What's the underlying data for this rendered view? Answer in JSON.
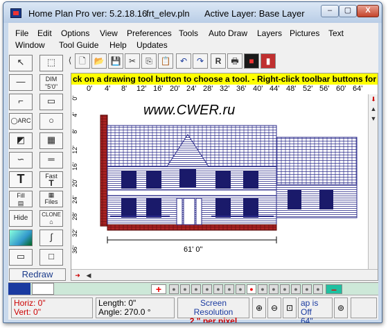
{
  "window": {
    "app_name": "Home Plan Pro ver: 5.2.18.16",
    "file_name": "frt_elev.pln",
    "active_layer": "Active Layer: Base Layer",
    "controls": [
      "–",
      "▢",
      "X"
    ]
  },
  "menu": {
    "row1": [
      "File",
      "Edit",
      "Options",
      "View",
      "Preferences",
      "Tools",
      "Auto Draw",
      "Layers",
      "Pictures",
      "Text"
    ],
    "row2": [
      "Window",
      "Tool Guide",
      "Help",
      "Updates"
    ]
  },
  "toolbar": {
    "icons": [
      "frame-icon",
      "new-file-icon",
      "open-folder-icon",
      "save-icon",
      "cut-icon",
      "copy-icon",
      "paste-icon",
      "undo-icon",
      "redo-icon",
      "print-preview-icon",
      "print-icon",
      "color-picker-icon",
      "help-icon"
    ]
  },
  "tools": [
    {
      "label": "",
      "icon": "arrow-select-icon"
    },
    {
      "label": "",
      "icon": "box-select-icon"
    },
    {
      "label": "",
      "icon": "line-tool-icon"
    },
    {
      "label": "DIM\n\"5'0\"\"",
      "icon": "dimension-tool-icon"
    },
    {
      "label": "",
      "icon": "wall-tool-icon"
    },
    {
      "label": "",
      "icon": "rectangle-tool-icon"
    },
    {
      "label": "ARC",
      "icon": "arc-tool-icon"
    },
    {
      "label": "",
      "icon": "circle-tool-icon"
    },
    {
      "label": "",
      "icon": "door-tool-icon"
    },
    {
      "label": "",
      "icon": "window-tool-icon"
    },
    {
      "label": "",
      "icon": "curve-tool-icon"
    },
    {
      "label": "",
      "icon": "double-line-tool-icon"
    },
    {
      "label": "T",
      "icon": "text-tool-icon"
    },
    {
      "label": "Fast",
      "icon": "fast-text-tool-icon"
    },
    {
      "label": "Fill",
      "icon": "fill-tool-icon"
    },
    {
      "label": "Files",
      "icon": "files-tool-icon"
    },
    {
      "label": "Hide",
      "icon": "hide-tool-icon"
    },
    {
      "label": "CLONE",
      "icon": "clone-tool-icon"
    },
    {
      "label": "",
      "icon": "image-tool-icon"
    },
    {
      "label": "",
      "icon": "freehand-tool-icon"
    },
    {
      "label": "",
      "icon": "plain-rect-tool-icon"
    },
    {
      "label": "",
      "icon": "square-tool-icon"
    }
  ],
  "redraw_label": "Redraw",
  "message": "ck on a drawing tool button to choose a tool.  -  Right-click toolbar buttons for",
  "ruler_h": [
    "0'",
    "4'",
    "8'",
    "12'",
    "16'",
    "20'",
    "24'",
    "28'",
    "32'",
    "36'",
    "40'",
    "44'",
    "48'",
    "52'",
    "56'",
    "60'",
    "64'"
  ],
  "ruler_v": [
    "0'",
    "4'",
    "8'",
    "12'",
    "16'",
    "20'",
    "24'",
    "28'",
    "32'",
    "36'"
  ],
  "watermark": "www.CWER.ru",
  "dimension_label": "61' 0\"",
  "status": {
    "horiz": "Horiz: 0\"",
    "vert": "Vert:  0\"",
    "length": "Length:  0\"",
    "angle": "Angle:  270.0 °",
    "screen_res_title": "Screen Resolution",
    "screen_res_value": "2 \" per pixel",
    "snap_partial": "ap is Off",
    "snap_partial2": "64\""
  },
  "colors": {
    "message_bg": "#ffff00",
    "house_line": "#2a2a8a",
    "brick": "#8a1a1a",
    "layer_bar": "#cde8d8"
  }
}
